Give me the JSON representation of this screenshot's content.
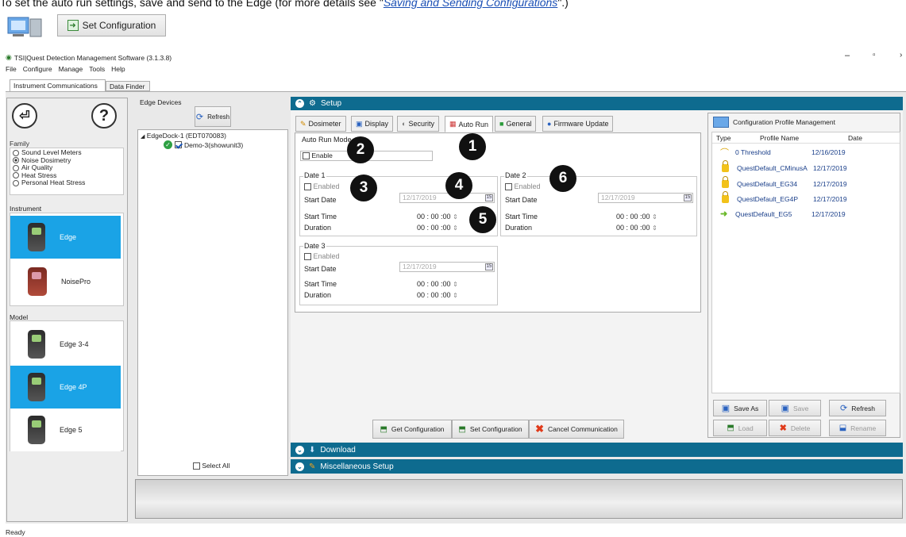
{
  "instruction": {
    "text": "To set the auto run settings, save and send to the Edge (for more details see",
    "link": "Saving and Sending Configurations",
    "tail": ".)",
    "button_label": "Set Configuration"
  },
  "window": {
    "title": "TSI|Quest Detection Management Software (3.1.3.8)",
    "menu": [
      "File",
      "Configure",
      "Manage",
      "Tools",
      "Help"
    ],
    "tabs": [
      "Instrument Communications",
      "Data Finder"
    ],
    "status": "Ready"
  },
  "left": {
    "family_label": "Family",
    "families": [
      {
        "label": "Sound Level Meters",
        "selected": false
      },
      {
        "label": "Noise Dosimetry",
        "selected": true
      },
      {
        "label": "Air Quality",
        "selected": false
      },
      {
        "label": "Heat Stress",
        "selected": false
      },
      {
        "label": "Personal Heat Stress",
        "selected": false
      }
    ],
    "instrument_label": "Instrument",
    "instruments": [
      {
        "label": "Edge",
        "selected": true
      },
      {
        "label": "NoisePro",
        "selected": false
      }
    ],
    "model_label": "Model",
    "models": [
      {
        "label": "Edge 3-4",
        "selected": false
      },
      {
        "label": "Edge 4P",
        "selected": true
      },
      {
        "label": "Edge 5",
        "selected": false
      }
    ]
  },
  "devices": {
    "header": "Edge Devices",
    "refresh": "Refresh",
    "dock": "EdgeDock-1 (EDT070083)",
    "unit": "Demo-3(showunit3)",
    "select_all": "Select All"
  },
  "setup": {
    "title": "Setup",
    "tabs": [
      "Dosimeter",
      "Display",
      "Security",
      "Auto Run",
      "General",
      "Firmware Update"
    ],
    "active_tab": "Auto Run",
    "mode_label": "Auto Run Mode",
    "enable": "Enable",
    "dates": [
      {
        "title": "Date 1",
        "enabled": "Enabled",
        "start_date_label": "Start Date",
        "start_date": "12/17/2019",
        "start_time_label": "Start Time",
        "start_time": "00 : 00 :00",
        "duration_label": "Duration",
        "duration": "00 : 00 :00"
      },
      {
        "title": "Date 2",
        "enabled": "Enabled",
        "start_date_label": "Start Date",
        "start_date": "12/17/2019",
        "start_time_label": "Start Time",
        "start_time": "00 : 00 :00",
        "duration_label": "Duration",
        "duration": "00 : 00 :00"
      },
      {
        "title": "Date 3",
        "enabled": "Enabled",
        "start_date_label": "Start Date",
        "start_date": "12/17/2019",
        "start_time_label": "Start Time",
        "start_time": "00 : 00 :00",
        "duration_label": "Duration",
        "duration": "00 : 00 :00"
      }
    ],
    "cal_glyph": "15",
    "spin_glyph": "⇕",
    "get_config": "Get Configuration",
    "set_config": "Set Configuration",
    "cancel_comm": "Cancel Communication"
  },
  "profiles": {
    "title": "Configuration Profile Management",
    "col_type": "Type",
    "col_name": "Profile Name",
    "col_date": "Date",
    "rows": [
      {
        "name": "0 Threshold",
        "date": "12/16/2019",
        "icon": "open-lock-icon"
      },
      {
        "name": "QuestDefault_CMinusA",
        "date": "12/17/2019",
        "icon": "lock-icon"
      },
      {
        "name": "QuestDefault_EG34",
        "date": "12/17/2019",
        "icon": "lock-icon"
      },
      {
        "name": "QuestDefault_EG4P",
        "date": "12/17/2019",
        "icon": "lock-icon"
      },
      {
        "name": "QuestDefault_EG5",
        "date": "12/17/2019",
        "icon": "arrow-icon"
      }
    ],
    "save_as": "Save As",
    "save": "Save",
    "refresh": "Refresh",
    "load": "Load",
    "delete": "Delete",
    "rename": "Rename"
  },
  "sections": {
    "download": "Download",
    "misc": "Miscellaneous Setup"
  },
  "callouts": [
    "1",
    "2",
    "3",
    "4",
    "5",
    "6"
  ]
}
